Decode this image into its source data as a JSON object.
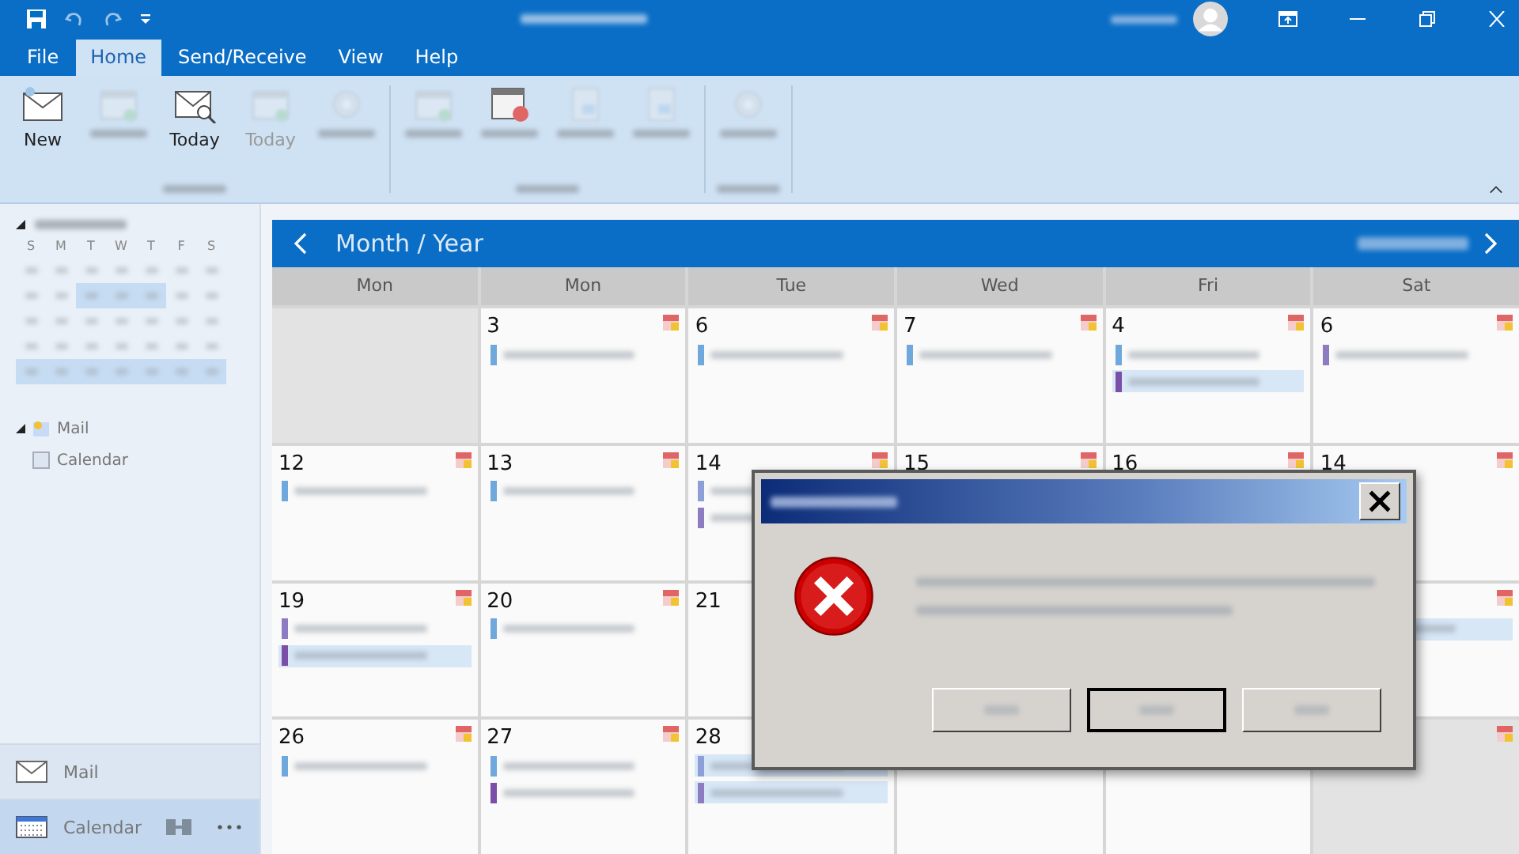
{
  "tabs": [
    {
      "label": "File",
      "selected": false
    },
    {
      "label": "Home",
      "selected": true
    },
    {
      "label": "Send/Receive",
      "selected": false
    },
    {
      "label": "View",
      "selected": false
    },
    {
      "label": "Help",
      "selected": false
    }
  ],
  "ribbon": {
    "groups": [
      {
        "items": [
          {
            "kind": "envelope",
            "label": "New",
            "disabled": false
          },
          {
            "kind": "calendar",
            "disabled": true
          },
          {
            "kind": "today",
            "label": "Today",
            "disabled": false
          },
          {
            "kind": "calendar",
            "label": "Today",
            "disabled": true
          },
          {
            "kind": "gear",
            "disabled": true
          }
        ]
      },
      {
        "items": [
          {
            "kind": "calendar",
            "disabled": true
          },
          {
            "kind": "cancel",
            "disabled": false
          },
          {
            "kind": "page",
            "disabled": true
          },
          {
            "kind": "page",
            "disabled": true
          }
        ]
      },
      {
        "items": [
          {
            "kind": "gear",
            "disabled": true
          }
        ]
      }
    ]
  },
  "mini_calendar": {
    "weekdays": [
      "S",
      "M",
      "T",
      "W",
      "T",
      "F",
      "S"
    ],
    "weeks": [
      {
        "days": [
          false,
          false,
          false,
          false,
          false,
          false,
          false
        ]
      },
      {
        "days": [
          false,
          false,
          true,
          true,
          true,
          false,
          false
        ]
      },
      {
        "days": [
          false,
          false,
          false,
          false,
          false,
          false,
          false
        ]
      },
      {
        "days": [
          false,
          false,
          false,
          false,
          false,
          false,
          false
        ]
      },
      {
        "days": [
          true,
          true,
          true,
          true,
          true,
          true,
          true
        ]
      }
    ]
  },
  "folders": [
    {
      "label": "Mail",
      "expanded": true,
      "children": [
        {
          "label": "Calendar"
        }
      ]
    }
  ],
  "nav": [
    {
      "label": "Mail",
      "kind": "mail",
      "selected": false
    },
    {
      "label": "Calendar",
      "kind": "calendar",
      "selected": true
    }
  ],
  "calendar": {
    "title": "Month / Year",
    "headers": [
      "Mon",
      "Mon",
      "Tue",
      "Wed",
      "Fri",
      "Sat"
    ],
    "weeks": [
      [
        {
          "empty": true
        },
        {
          "day": "3",
          "icon": true,
          "events": [
            {
              "color": "#6fa8dc",
              "selected": false
            }
          ]
        },
        {
          "day": "6",
          "icon": true,
          "events": [
            {
              "color": "#6fa8dc",
              "selected": false
            }
          ]
        },
        {
          "day": "7",
          "icon": true,
          "events": [
            {
              "color": "#6fa8dc",
              "selected": false
            }
          ]
        },
        {
          "day": "4",
          "icon": true,
          "events": [
            {
              "color": "#6fa8dc",
              "selected": false
            },
            {
              "color": "#7b4fa8",
              "selected": true
            }
          ]
        },
        {
          "day": "6",
          "icon": true,
          "events": [
            {
              "color": "#8e7cc3",
              "selected": false
            }
          ]
        }
      ],
      [
        {
          "day": "12",
          "icon": true,
          "events": [
            {
              "color": "#6fa8dc",
              "selected": false
            }
          ]
        },
        {
          "day": "13",
          "icon": true,
          "events": [
            {
              "color": "#6fa8dc",
              "selected": false
            }
          ]
        },
        {
          "day": "14",
          "icon": true,
          "events": [
            {
              "color": "#8e9fd8",
              "selected": false
            },
            {
              "color": "#8e7cc3",
              "selected": false
            }
          ]
        },
        {
          "day": "15",
          "icon": true
        },
        {
          "day": "16",
          "icon": true
        },
        {
          "day": "14",
          "icon": true
        }
      ],
      [
        {
          "day": "19",
          "icon": true,
          "events": [
            {
              "color": "#8e7cc3",
              "selected": false
            },
            {
              "color": "#7b4fa8",
              "selected": true
            }
          ]
        },
        {
          "day": "20",
          "icon": true,
          "events": [
            {
              "color": "#6fa8dc",
              "selected": false
            }
          ]
        },
        {
          "day": "21"
        },
        {
          "icon": true,
          "events": [
            {
              "selected": true
            }
          ]
        }
      ],
      [
        {
          "day": "26",
          "icon": true,
          "events": [
            {
              "color": "#6fa8dc",
              "selected": false
            }
          ]
        },
        {
          "day": "27",
          "icon": true,
          "events": [
            {
              "color": "#6fa8dc",
              "selected": false
            },
            {
              "color": "#7b4fa8",
              "selected": false
            }
          ]
        },
        {
          "day": "28",
          "icon": false,
          "events": [
            {
              "color": "#8e9fd8",
              "selected": true
            },
            {
              "color": "#8e7cc3",
              "selected": true
            }
          ]
        },
        {
          "empty": true,
          "icon": true
        }
      ]
    ]
  },
  "dialog": {
    "buttons": [
      {
        "default": false
      },
      {
        "default": true
      },
      {
        "default": false
      }
    ]
  }
}
